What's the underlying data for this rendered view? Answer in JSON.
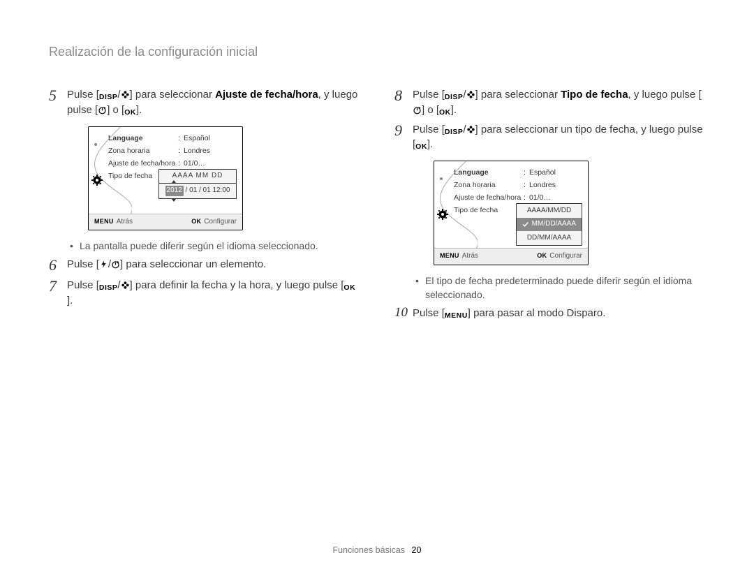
{
  "header": {
    "title": "Realización de la configuración inicial"
  },
  "keys": {
    "disp": "DISP",
    "ok": "OK",
    "menu": "MENU"
  },
  "left": {
    "step5": {
      "num": "5",
      "a": "Pulse [",
      "b": "] para seleccionar ",
      "bold": "Ajuste de fecha/hora",
      "c": ", y luego pulse [",
      "d": "] o [",
      "e": "]."
    },
    "lcd": {
      "rows": [
        {
          "lab": "Language",
          "val": "Español",
          "bold": true
        },
        {
          "lab": "Zona horaria",
          "val": "Londres"
        },
        {
          "lab": "Ajuste de fecha/hora",
          "val": "01/0…"
        },
        {
          "lab": "Tipo de fecha",
          "val": ""
        }
      ],
      "date_fmt_selected": "AAAA  MM  DD",
      "date_value": {
        "year": "2012",
        "rest": " / 01 / 01 12:00"
      },
      "foot_back": "Atrás",
      "foot_set": "Configurar"
    },
    "bullet": "La pantalla puede diferir según el idioma seleccionado.",
    "step6": {
      "num": "6",
      "a": "Pulse [",
      "b": "] para seleccionar un elemento."
    },
    "step7": {
      "num": "7",
      "a": "Pulse [",
      "b": "] para definir la fecha y la hora, y luego pulse [",
      "c": "]."
    }
  },
  "right": {
    "step8": {
      "num": "8",
      "a": "Pulse [",
      "b": "] para seleccionar ",
      "bold": "Tipo de fecha",
      "c": ", y luego pulse [",
      "d": "] o [",
      "e": "]."
    },
    "step9": {
      "num": "9",
      "a": "Pulse [",
      "b": "] para seleccionar un tipo de fecha, y luego pulse [",
      "c": "]."
    },
    "lcd": {
      "rows": [
        {
          "lab": "Language",
          "val": "Español",
          "bold": true
        },
        {
          "lab": "Zona horaria",
          "val": "Londres"
        },
        {
          "lab": "Ajuste de fecha/hora",
          "val": "01/0…"
        },
        {
          "lab": "Tipo de fecha",
          "val": ""
        }
      ],
      "type_options": [
        "AAAA/MM/DD",
        "MM/DD/AAAA",
        "DD/MM/AAAA"
      ],
      "type_selected_index": 1,
      "foot_back": "Atrás",
      "foot_set": "Configurar"
    },
    "bullet": "El tipo de fecha predeterminado puede diferir según el idioma seleccionado.",
    "step10": {
      "num": "10",
      "a": "Pulse [",
      "b": "] para pasar al modo Disparo."
    }
  },
  "footer": {
    "section": "Funciones básicas",
    "page": "20"
  }
}
